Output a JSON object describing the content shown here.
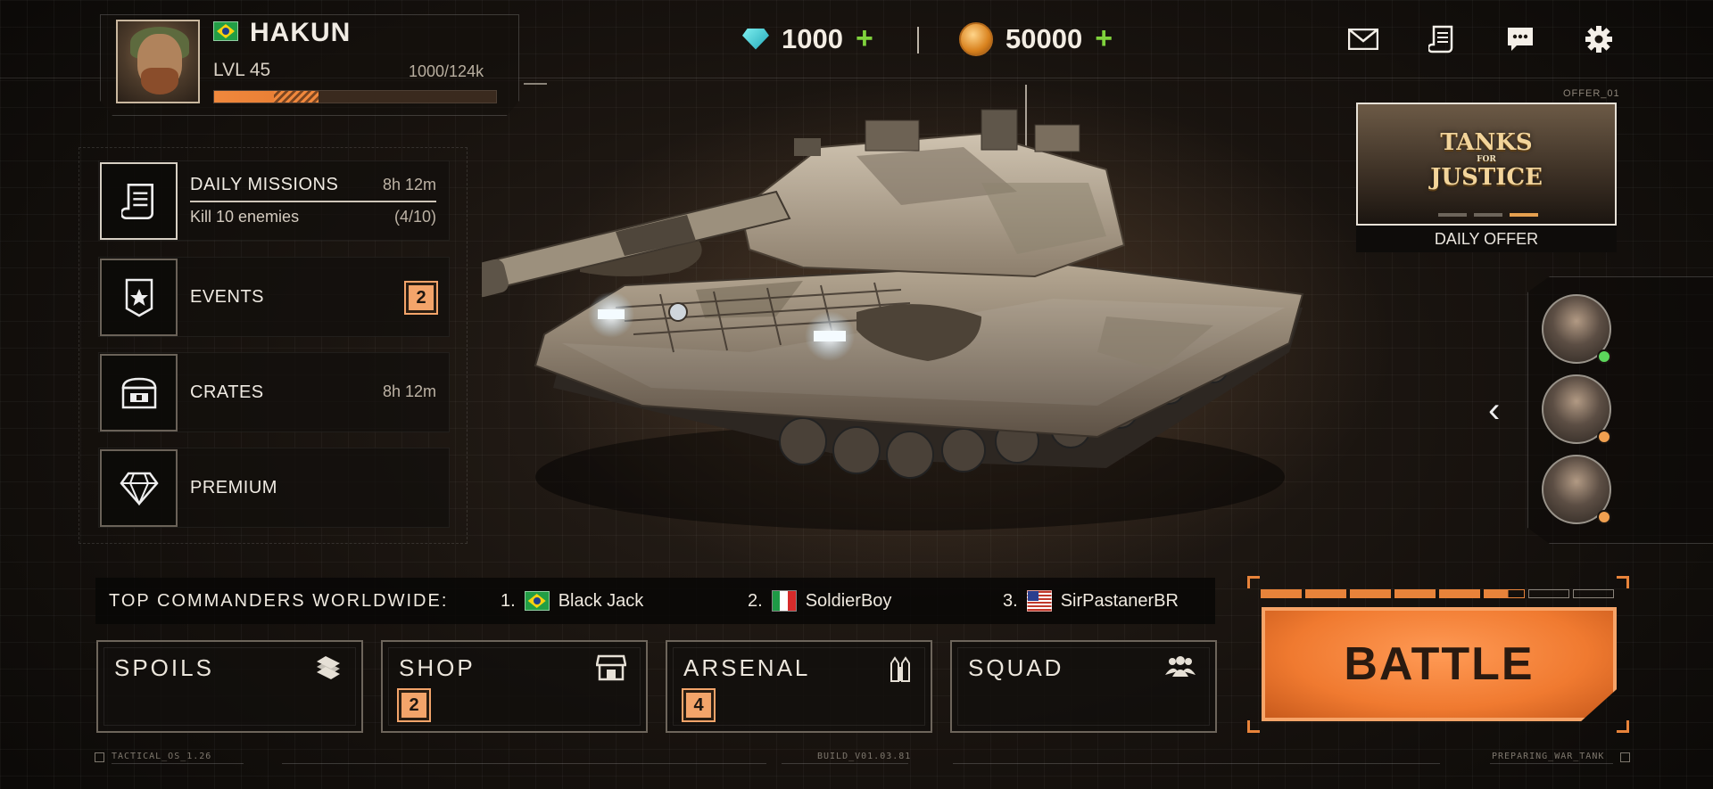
{
  "player": {
    "name": "HAKUN",
    "level": "LVL 45",
    "xp": "1000/124k",
    "xp_progress": 0.37
  },
  "currencies": {
    "gems": "1000",
    "coins": "50000",
    "plus": "+"
  },
  "top_icons": [
    "mail-icon",
    "missions-scroll-icon",
    "chat-icon",
    "settings-gear-icon"
  ],
  "menu": {
    "daily_missions": {
      "label": "DAILY MISSIONS",
      "timer": "8h 12m",
      "task": "Kill 10 enemies",
      "progress": "(4/10)"
    },
    "events": {
      "label": "EVENTS",
      "badge": "2"
    },
    "crates": {
      "label": "CRATES",
      "timer": "8h 12m"
    },
    "premium": {
      "label": "PREMIUM"
    }
  },
  "offer": {
    "tag": "OFFER_01",
    "title_line1": "TANKS",
    "title_small": "FOR",
    "title_line2": "JUSTICE",
    "label": "DAILY OFFER",
    "slides": 3,
    "active_slide": 3
  },
  "squad_members": [
    {
      "status": "online",
      "status_color": "#5cd65c"
    },
    {
      "status": "away",
      "status_color": "#f0a050"
    },
    {
      "status": "away",
      "status_color": "#f0a050"
    }
  ],
  "leaderboard": {
    "title": "TOP COMMANDERS WORLDWIDE:",
    "entries": [
      {
        "rank": "1.",
        "name": "Black Jack",
        "country": "Brazil"
      },
      {
        "rank": "2.",
        "name": "SoldierBoy",
        "country": "Italy"
      },
      {
        "rank": "3.",
        "name": "SirPastanerBR",
        "country": "USA"
      }
    ]
  },
  "tabs": {
    "spoils": {
      "label": "SPOILS"
    },
    "shop": {
      "label": "SHOP",
      "badge": "2"
    },
    "arsenal": {
      "label": "ARSENAL",
      "badge": "4"
    },
    "squad": {
      "label": "SQUAD"
    }
  },
  "battle": {
    "label": "BATTLE",
    "energy_segments": 8,
    "energy_filled": 5.6
  },
  "footer": {
    "left": "TACTICAL_OS_1.26",
    "center": "BUILD_V01.03.81",
    "right": "PREPARING_WAR_TANK"
  },
  "colors": {
    "accent": "#f07a30",
    "online": "#5cd65c",
    "away": "#f0a050",
    "plus": "#7fd23c"
  }
}
